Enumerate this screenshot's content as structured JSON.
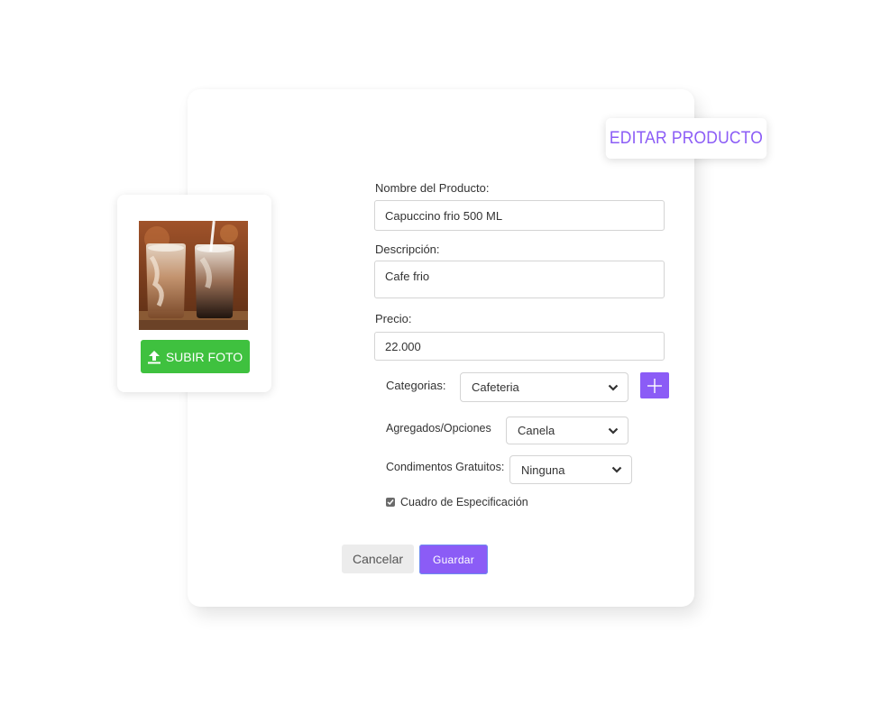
{
  "page": {
    "title": "EDITAR PRODUCTO"
  },
  "photo": {
    "upload_label": "SUBIR FOTO",
    "upload_icon": "upload-arrow-icon"
  },
  "form": {
    "name": {
      "label": "Nombre del Producto:",
      "value": "Capuccino frio 500 ML"
    },
    "description": {
      "label": "Descripción:",
      "value": "Cafe frio"
    },
    "price": {
      "label": "Precio:",
      "value": "22.000"
    },
    "categories": {
      "label": "Categorias:",
      "selected": "Cafeteria",
      "add_icon": "plus-icon"
    },
    "addons": {
      "label": "Agregados/Opciones",
      "selected": "Canela"
    },
    "condiments": {
      "label": "Condimentos Gratuitos:",
      "selected": "Ninguna"
    },
    "spec_box": {
      "label": "Cuadro de Especificación",
      "checked": true
    }
  },
  "actions": {
    "cancel_label": "Cancelar",
    "save_label": "Guardar"
  },
  "colors": {
    "accent": "#8b5cf6",
    "upload_green": "#3fc13f"
  }
}
